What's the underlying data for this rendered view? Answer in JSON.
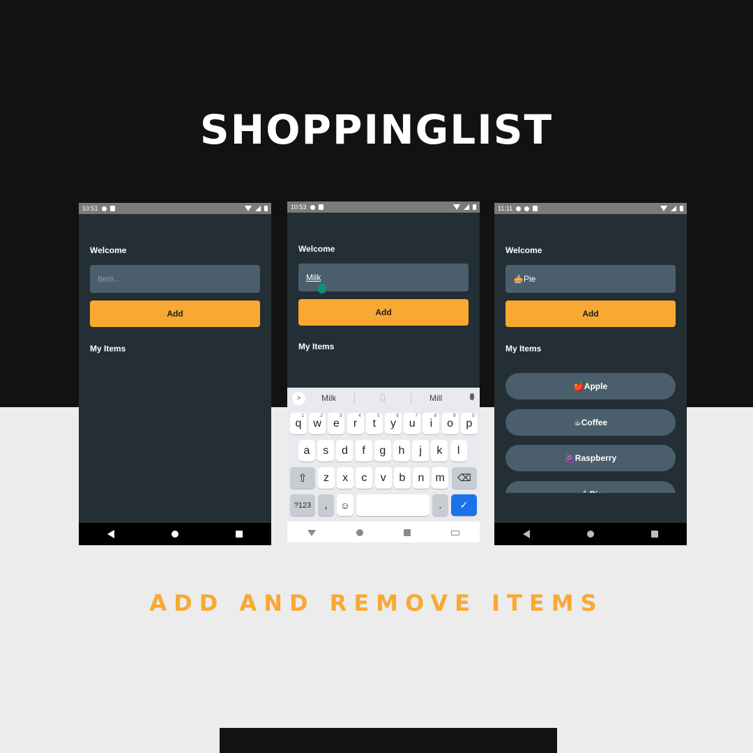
{
  "headline": "SHOPPINGLIST",
  "subline": "ADD AND REMOVE ITEMS",
  "colors": {
    "accent": "#f9a832",
    "card": "#242e35",
    "field": "#4a5f6b",
    "keyboard_action": "#1a73e8"
  },
  "screens": [
    {
      "time": "10:51",
      "welcome": "Welcome",
      "input_placeholder": "Item...",
      "add_label": "Add",
      "my_items": "My Items",
      "items": []
    },
    {
      "time": "10:53",
      "welcome": "Welcome",
      "input_value": "Milk",
      "add_label": "Add",
      "my_items": "My Items",
      "keyboard": {
        "suggestions": [
          "Milk",
          "Mill"
        ],
        "row1": [
          {
            "k": "q",
            "h": "1"
          },
          {
            "k": "w",
            "h": "2"
          },
          {
            "k": "e",
            "h": "3"
          },
          {
            "k": "r",
            "h": "4"
          },
          {
            "k": "t",
            "h": "5"
          },
          {
            "k": "y",
            "h": "6"
          },
          {
            "k": "u",
            "h": "7"
          },
          {
            "k": "i",
            "h": "8"
          },
          {
            "k": "o",
            "h": "9"
          },
          {
            "k": "p",
            "h": "0"
          }
        ],
        "row2": [
          "a",
          "s",
          "d",
          "f",
          "g",
          "h",
          "j",
          "k",
          "l"
        ],
        "row3": [
          "z",
          "x",
          "c",
          "v",
          "b",
          "n",
          "m"
        ],
        "symbols": "?123",
        "comma": ",",
        "period": ".",
        "icons": [
          "chevron-right-icon",
          "clipboard-icon",
          "mic-icon",
          "shift-icon",
          "backspace-icon",
          "emoji-icon",
          "check-icon"
        ]
      }
    },
    {
      "time": "11:11",
      "welcome": "Welcome",
      "input_value": "🥧Pie",
      "add_label": "Add",
      "my_items": "My Items",
      "items": [
        "🍎Apple",
        "☕Coffee",
        "🍇Raspberry",
        "🥧Pie"
      ]
    }
  ]
}
